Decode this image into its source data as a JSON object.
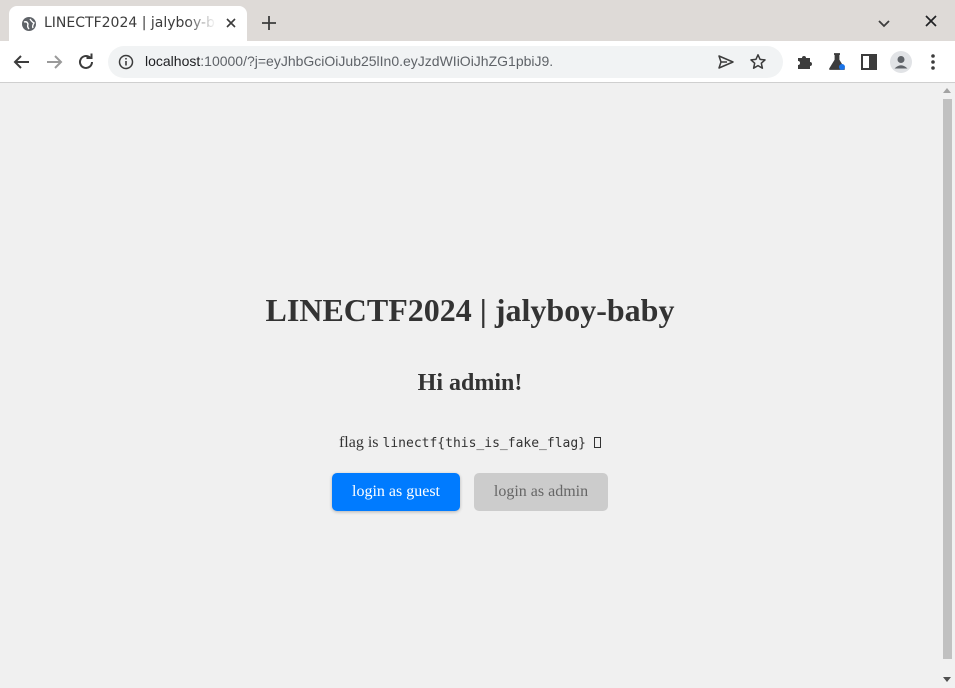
{
  "browser": {
    "tab": {
      "title": "LINECTF2024 | jalyboy-baby",
      "favicon": "globe-icon"
    },
    "address": {
      "host": "localhost",
      "rest": ":10000/?j=eyJhbGciOiJub25lIn0.eyJzdWIiOiJhZG1pbiJ9."
    },
    "icons": {
      "back": "back-arrow-icon",
      "forward": "forward-arrow-icon",
      "reload": "reload-icon",
      "info": "info-icon",
      "send": "send-icon",
      "bookmark": "star-icon",
      "extensions": "puzzle-icon",
      "labs": "flask-icon",
      "side_panel": "side-panel-icon",
      "profile": "profile-icon",
      "menu": "kebab-menu-icon"
    }
  },
  "page": {
    "title": "LINECTF2024 | jalyboy-baby",
    "greeting": "Hi admin!",
    "flag_prefix": "flag is",
    "flag_value": "linectf{this_is_fake_flag}",
    "buttons": {
      "guest": "login as guest",
      "admin": "login as admin"
    }
  },
  "colors": {
    "primary_button": "#007bff",
    "disabled_button": "#cccccc",
    "page_bg": "#f0f0f0"
  }
}
